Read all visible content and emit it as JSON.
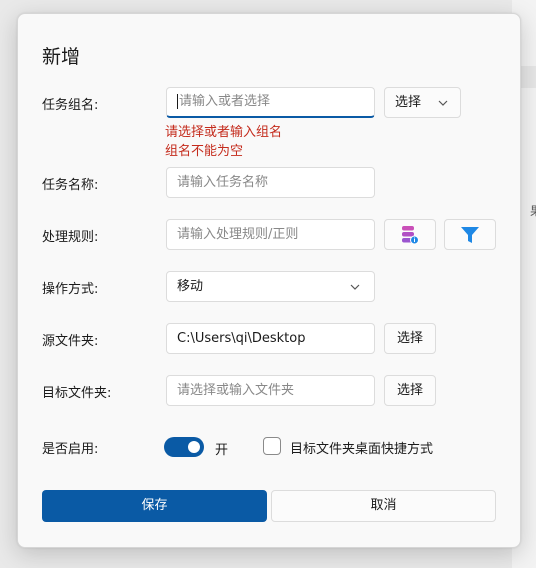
{
  "background": {
    "partial_text": "果"
  },
  "dialog": {
    "title": "新增",
    "group": {
      "label": "任务组名:",
      "placeholder": "请输入或者选择",
      "select_label": "选择",
      "errors": [
        "请选择或者输入组名",
        "组名不能为空"
      ]
    },
    "task_name": {
      "label": "任务名称:",
      "placeholder": "请输入任务名称"
    },
    "rule": {
      "label": "处理规则:",
      "placeholder": "请输入处理规则/正则",
      "database_icon": "database-info-icon",
      "filter_icon": "filter-icon"
    },
    "operation": {
      "label": "操作方式:",
      "value": "移动"
    },
    "source_folder": {
      "label": "源文件夹:",
      "value": "C:\\Users\\qi\\Desktop",
      "button": "选择"
    },
    "target_folder": {
      "label": "目标文件夹:",
      "placeholder": "请选择或输入文件夹",
      "button": "选择"
    },
    "enabled": {
      "label": "是否启用:",
      "toggle_text": "开",
      "toggle_on": true
    },
    "shortcut": {
      "label": "目标文件夹桌面快捷方式",
      "checked": false
    },
    "buttons": {
      "save": "保存",
      "cancel": "取消"
    }
  },
  "colors": {
    "accent": "#0A5AA5",
    "error": "#C42B1C",
    "filter_icon": "#1E88E5",
    "database_icon": "#C94FB8"
  }
}
